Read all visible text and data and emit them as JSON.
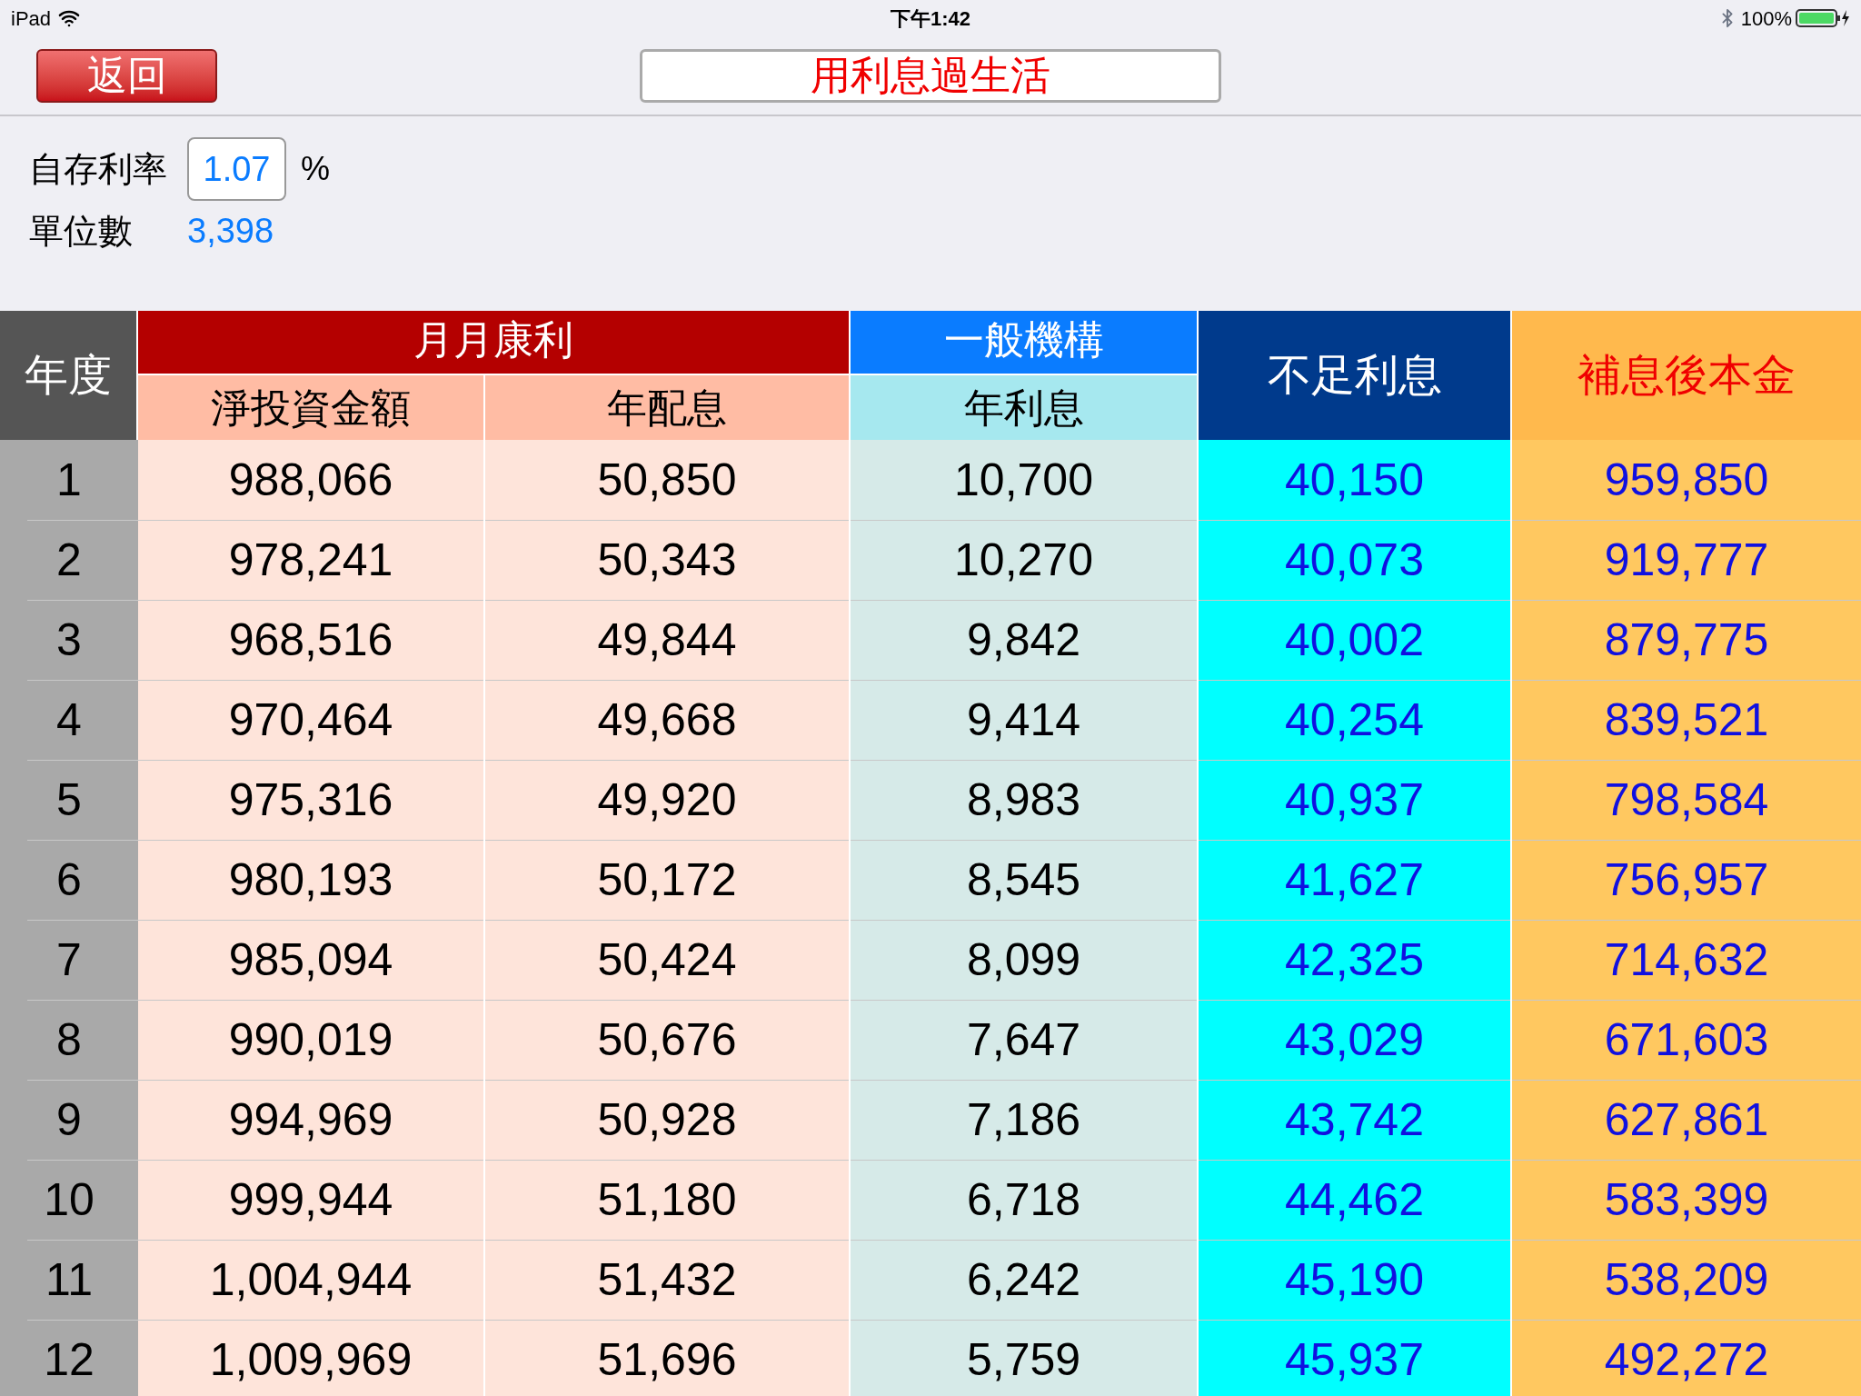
{
  "status_bar": {
    "device": "iPad",
    "time": "下午1:42",
    "battery": "100%"
  },
  "nav": {
    "back": "返回",
    "title": "用利息過生活"
  },
  "inputs": {
    "rate_label": "自存利率",
    "rate_value": "1.07",
    "rate_unit": "%",
    "units_label": "單位數",
    "units_value": "3,398"
  },
  "table": {
    "year_heading": "年度",
    "groups": [
      {
        "title": "月月康利",
        "columns": [
          "淨投資金額",
          "年配息"
        ]
      },
      {
        "title": "一般機構",
        "columns": [
          "年利息"
        ]
      }
    ],
    "shortfall_heading": "不足利息",
    "principal_heading": "補息後本金",
    "rows": [
      [
        "1",
        "988,066",
        "50,850",
        "10,700",
        "40,150",
        "959,850"
      ],
      [
        "2",
        "978,241",
        "50,343",
        "10,270",
        "40,073",
        "919,777"
      ],
      [
        "3",
        "968,516",
        "49,844",
        "9,842",
        "40,002",
        "879,775"
      ],
      [
        "4",
        "970,464",
        "49,668",
        "9,414",
        "40,254",
        "839,521"
      ],
      [
        "5",
        "975,316",
        "49,920",
        "8,983",
        "40,937",
        "798,584"
      ],
      [
        "6",
        "980,193",
        "50,172",
        "8,545",
        "41,627",
        "756,957"
      ],
      [
        "7",
        "985,094",
        "50,424",
        "8,099",
        "42,325",
        "714,632"
      ],
      [
        "8",
        "990,019",
        "50,676",
        "7,647",
        "43,029",
        "671,603"
      ],
      [
        "9",
        "994,969",
        "50,928",
        "7,186",
        "43,742",
        "627,861"
      ],
      [
        "10",
        "999,944",
        "51,180",
        "6,718",
        "44,462",
        "583,399"
      ],
      [
        "11",
        "1,004,944",
        "51,432",
        "6,242",
        "45,190",
        "538,209"
      ],
      [
        "12",
        "1,009,969",
        "51,696",
        "5,759",
        "45,937",
        "492,272"
      ]
    ]
  }
}
